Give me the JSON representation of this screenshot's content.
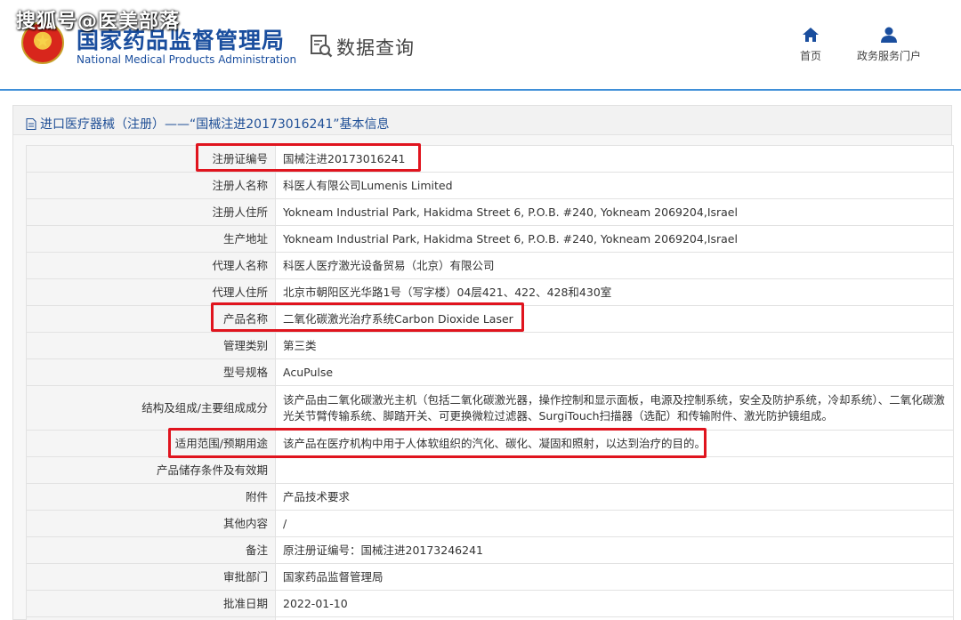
{
  "watermark": "搜狐号@医美部落",
  "header": {
    "org_cn": "国家药品监督管理局",
    "org_en": "National Medical Products Administration",
    "query_title": "数据查询",
    "nav": [
      {
        "label": "首页",
        "icon": "home-icon"
      },
      {
        "label": "政务服务门户",
        "icon": "user-icon"
      }
    ]
  },
  "panel": {
    "title": "进口医疗器械（注册）——“国械注进20173016241”基本信息"
  },
  "rows": [
    {
      "label": "注册证编号",
      "value": "国械注进20173016241"
    },
    {
      "label": "注册人名称",
      "value": "科医人有限公司Lumenis Limited"
    },
    {
      "label": "注册人住所",
      "value": "Yokneam Industrial Park, Hakidma Street 6, P.O.B. #240, Yokneam 2069204,Israel"
    },
    {
      "label": "生产地址",
      "value": "Yokneam Industrial Park, Hakidma Street 6, P.O.B. #240, Yokneam 2069204,Israel"
    },
    {
      "label": "代理人名称",
      "value": "科医人医疗激光设备贸易（北京）有限公司"
    },
    {
      "label": "代理人住所",
      "value": "北京市朝阳区光华路1号（写字楼）04层421、422、428和430室"
    },
    {
      "label": "产品名称",
      "value": "二氧化碳激光治疗系统Carbon Dioxide Laser"
    },
    {
      "label": "管理类别",
      "value": "第三类"
    },
    {
      "label": "型号规格",
      "value": "AcuPulse"
    },
    {
      "label": "结构及组成/主要组成成分",
      "value": "该产品由二氧化碳激光主机（包括二氧化碳激光器，操作控制和显示面板，电源及控制系统，安全及防护系统，冷却系统）、二氧化碳激光关节臂传输系统、脚踏开关、可更换微粒过滤器、SurgiTouch扫描器（选配）和传输附件、激光防护镜组成。"
    },
    {
      "label": "适用范围/预期用途",
      "value": "该产品在医疗机构中用于人体软组织的汽化、碳化、凝固和照射，以达到治疗的目的。"
    },
    {
      "label": "产品储存条件及有效期",
      "value": ""
    },
    {
      "label": "附件",
      "value": "产品技术要求"
    },
    {
      "label": "其他内容",
      "value": "/"
    },
    {
      "label": "备注",
      "value": "原注册证编号：国械注进20173246241"
    },
    {
      "label": "审批部门",
      "value": "国家药品监督管理局"
    },
    {
      "label": "批准日期",
      "value": "2022-01-10"
    },
    {
      "label": "",
      "value": ""
    }
  ],
  "colors": {
    "accent_blue": "#1a4e9e",
    "highlight_red": "#e0141e",
    "header_line": "#3f8fd8"
  }
}
